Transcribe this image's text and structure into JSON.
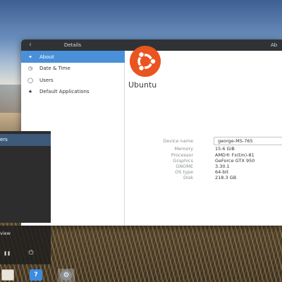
{
  "window": {
    "sidebar_title": "Details",
    "panel_title": "Ab",
    "back_icon": "chevron-left-icon"
  },
  "sidebar": {
    "items": [
      {
        "label": "About",
        "icon": "star-sparkle-icon",
        "active": true
      },
      {
        "label": "Date & Time",
        "icon": "clock-icon",
        "active": false
      },
      {
        "label": "Users",
        "icon": "user-icon",
        "active": false
      },
      {
        "label": "Default Applications",
        "icon": "star-icon",
        "active": false
      }
    ]
  },
  "about": {
    "distro_name": "Ubuntu",
    "logo_color": "#e95420",
    "details": [
      {
        "label": "Device name",
        "value": "george-MS-765"
      },
      {
        "label": "Memory",
        "value": "15.6 GiB"
      },
      {
        "label": "Processor",
        "value": "AMD® Fx(tm)-81"
      },
      {
        "label": "Graphics",
        "value": "GeForce GTX 950"
      },
      {
        "label": "GNOME",
        "value": "3.30.1"
      },
      {
        "label": "OS type",
        "value": "64-bit"
      },
      {
        "label": "Disk",
        "value": "218.3 GB"
      }
    ]
  },
  "system_menu": {
    "selected_label": "ers",
    "overview_label": "view"
  },
  "dock": {
    "help_label": "?"
  },
  "colors": {
    "accent": "#4a90d9",
    "titlebar": "#2f3336",
    "ubuntu_orange": "#e95420"
  }
}
